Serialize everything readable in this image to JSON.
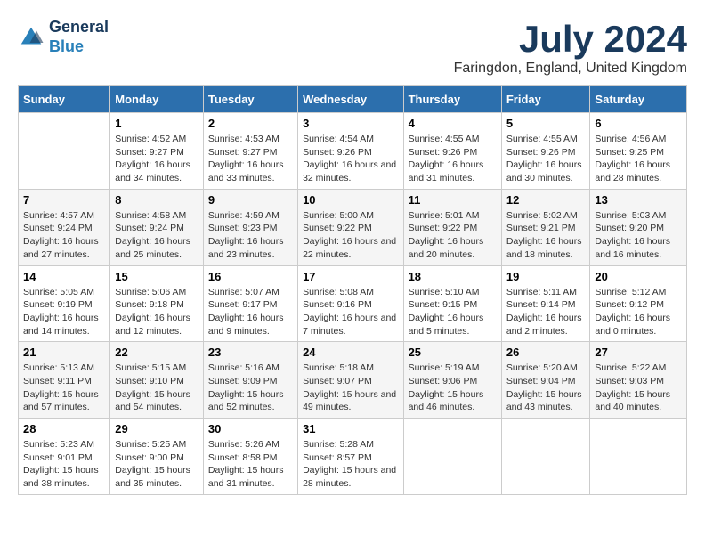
{
  "logo": {
    "line1": "General",
    "line2": "Blue"
  },
  "title": "July 2024",
  "subtitle": "Faringdon, England, United Kingdom",
  "days_of_week": [
    "Sunday",
    "Monday",
    "Tuesday",
    "Wednesday",
    "Thursday",
    "Friday",
    "Saturday"
  ],
  "weeks": [
    [
      {
        "day": "",
        "sunrise": "",
        "sunset": "",
        "daylight": ""
      },
      {
        "day": "1",
        "sunrise": "Sunrise: 4:52 AM",
        "sunset": "Sunset: 9:27 PM",
        "daylight": "Daylight: 16 hours and 34 minutes."
      },
      {
        "day": "2",
        "sunrise": "Sunrise: 4:53 AM",
        "sunset": "Sunset: 9:27 PM",
        "daylight": "Daylight: 16 hours and 33 minutes."
      },
      {
        "day": "3",
        "sunrise": "Sunrise: 4:54 AM",
        "sunset": "Sunset: 9:26 PM",
        "daylight": "Daylight: 16 hours and 32 minutes."
      },
      {
        "day": "4",
        "sunrise": "Sunrise: 4:55 AM",
        "sunset": "Sunset: 9:26 PM",
        "daylight": "Daylight: 16 hours and 31 minutes."
      },
      {
        "day": "5",
        "sunrise": "Sunrise: 4:55 AM",
        "sunset": "Sunset: 9:26 PM",
        "daylight": "Daylight: 16 hours and 30 minutes."
      },
      {
        "day": "6",
        "sunrise": "Sunrise: 4:56 AM",
        "sunset": "Sunset: 9:25 PM",
        "daylight": "Daylight: 16 hours and 28 minutes."
      }
    ],
    [
      {
        "day": "7",
        "sunrise": "Sunrise: 4:57 AM",
        "sunset": "Sunset: 9:24 PM",
        "daylight": "Daylight: 16 hours and 27 minutes."
      },
      {
        "day": "8",
        "sunrise": "Sunrise: 4:58 AM",
        "sunset": "Sunset: 9:24 PM",
        "daylight": "Daylight: 16 hours and 25 minutes."
      },
      {
        "day": "9",
        "sunrise": "Sunrise: 4:59 AM",
        "sunset": "Sunset: 9:23 PM",
        "daylight": "Daylight: 16 hours and 23 minutes."
      },
      {
        "day": "10",
        "sunrise": "Sunrise: 5:00 AM",
        "sunset": "Sunset: 9:22 PM",
        "daylight": "Daylight: 16 hours and 22 minutes."
      },
      {
        "day": "11",
        "sunrise": "Sunrise: 5:01 AM",
        "sunset": "Sunset: 9:22 PM",
        "daylight": "Daylight: 16 hours and 20 minutes."
      },
      {
        "day": "12",
        "sunrise": "Sunrise: 5:02 AM",
        "sunset": "Sunset: 9:21 PM",
        "daylight": "Daylight: 16 hours and 18 minutes."
      },
      {
        "day": "13",
        "sunrise": "Sunrise: 5:03 AM",
        "sunset": "Sunset: 9:20 PM",
        "daylight": "Daylight: 16 hours and 16 minutes."
      }
    ],
    [
      {
        "day": "14",
        "sunrise": "Sunrise: 5:05 AM",
        "sunset": "Sunset: 9:19 PM",
        "daylight": "Daylight: 16 hours and 14 minutes."
      },
      {
        "day": "15",
        "sunrise": "Sunrise: 5:06 AM",
        "sunset": "Sunset: 9:18 PM",
        "daylight": "Daylight: 16 hours and 12 minutes."
      },
      {
        "day": "16",
        "sunrise": "Sunrise: 5:07 AM",
        "sunset": "Sunset: 9:17 PM",
        "daylight": "Daylight: 16 hours and 9 minutes."
      },
      {
        "day": "17",
        "sunrise": "Sunrise: 5:08 AM",
        "sunset": "Sunset: 9:16 PM",
        "daylight": "Daylight: 16 hours and 7 minutes."
      },
      {
        "day": "18",
        "sunrise": "Sunrise: 5:10 AM",
        "sunset": "Sunset: 9:15 PM",
        "daylight": "Daylight: 16 hours and 5 minutes."
      },
      {
        "day": "19",
        "sunrise": "Sunrise: 5:11 AM",
        "sunset": "Sunset: 9:14 PM",
        "daylight": "Daylight: 16 hours and 2 minutes."
      },
      {
        "day": "20",
        "sunrise": "Sunrise: 5:12 AM",
        "sunset": "Sunset: 9:12 PM",
        "daylight": "Daylight: 16 hours and 0 minutes."
      }
    ],
    [
      {
        "day": "21",
        "sunrise": "Sunrise: 5:13 AM",
        "sunset": "Sunset: 9:11 PM",
        "daylight": "Daylight: 15 hours and 57 minutes."
      },
      {
        "day": "22",
        "sunrise": "Sunrise: 5:15 AM",
        "sunset": "Sunset: 9:10 PM",
        "daylight": "Daylight: 15 hours and 54 minutes."
      },
      {
        "day": "23",
        "sunrise": "Sunrise: 5:16 AM",
        "sunset": "Sunset: 9:09 PM",
        "daylight": "Daylight: 15 hours and 52 minutes."
      },
      {
        "day": "24",
        "sunrise": "Sunrise: 5:18 AM",
        "sunset": "Sunset: 9:07 PM",
        "daylight": "Daylight: 15 hours and 49 minutes."
      },
      {
        "day": "25",
        "sunrise": "Sunrise: 5:19 AM",
        "sunset": "Sunset: 9:06 PM",
        "daylight": "Daylight: 15 hours and 46 minutes."
      },
      {
        "day": "26",
        "sunrise": "Sunrise: 5:20 AM",
        "sunset": "Sunset: 9:04 PM",
        "daylight": "Daylight: 15 hours and 43 minutes."
      },
      {
        "day": "27",
        "sunrise": "Sunrise: 5:22 AM",
        "sunset": "Sunset: 9:03 PM",
        "daylight": "Daylight: 15 hours and 40 minutes."
      }
    ],
    [
      {
        "day": "28",
        "sunrise": "Sunrise: 5:23 AM",
        "sunset": "Sunset: 9:01 PM",
        "daylight": "Daylight: 15 hours and 38 minutes."
      },
      {
        "day": "29",
        "sunrise": "Sunrise: 5:25 AM",
        "sunset": "Sunset: 9:00 PM",
        "daylight": "Daylight: 15 hours and 35 minutes."
      },
      {
        "day": "30",
        "sunrise": "Sunrise: 5:26 AM",
        "sunset": "Sunset: 8:58 PM",
        "daylight": "Daylight: 15 hours and 31 minutes."
      },
      {
        "day": "31",
        "sunrise": "Sunrise: 5:28 AM",
        "sunset": "Sunset: 8:57 PM",
        "daylight": "Daylight: 15 hours and 28 minutes."
      },
      {
        "day": "",
        "sunrise": "",
        "sunset": "",
        "daylight": ""
      },
      {
        "day": "",
        "sunrise": "",
        "sunset": "",
        "daylight": ""
      },
      {
        "day": "",
        "sunrise": "",
        "sunset": "",
        "daylight": ""
      }
    ]
  ]
}
